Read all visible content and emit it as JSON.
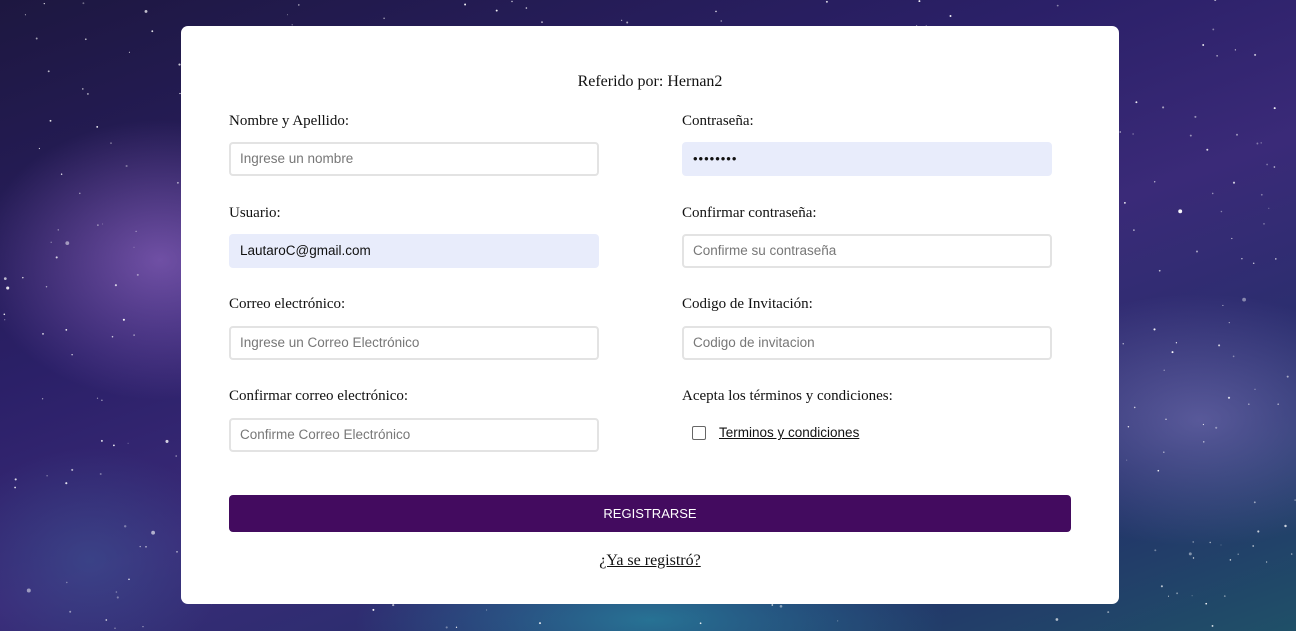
{
  "referral": {
    "text": "Referido por: Hernan2"
  },
  "left_column": [
    {
      "label": "Nombre y Apellido:",
      "value": "",
      "placeholder": "Ingrese un nombre"
    },
    {
      "label": "Usuario:",
      "value": "LautaroC@gmail.com",
      "placeholder": ""
    },
    {
      "label": "Correo electrónico:",
      "value": "",
      "placeholder": "Ingrese un Correo Electrónico"
    },
    {
      "label": "Confirmar correo electrónico:",
      "value": "",
      "placeholder": "Confirme Correo Electrónico"
    }
  ],
  "right_column": [
    {
      "label": "Contraseña:",
      "value": "••••••••",
      "placeholder": ""
    },
    {
      "label": "Confirmar contraseña:",
      "value": "",
      "placeholder": "Confirme su contraseña"
    },
    {
      "label": "Codigo de Invitación:",
      "value": "",
      "placeholder": "Codigo de invitacion"
    }
  ],
  "terms": {
    "label": "Acepta los términos y condiciones:",
    "link_text": "Terminos y condiciones",
    "checked": false
  },
  "submit": {
    "label": "REGISTRARSE"
  },
  "login_link": {
    "text": "¿Ya se registró?"
  },
  "colors": {
    "accent": "#430b5f",
    "autofill": "#e8ecfb",
    "card": "#ffffff"
  }
}
